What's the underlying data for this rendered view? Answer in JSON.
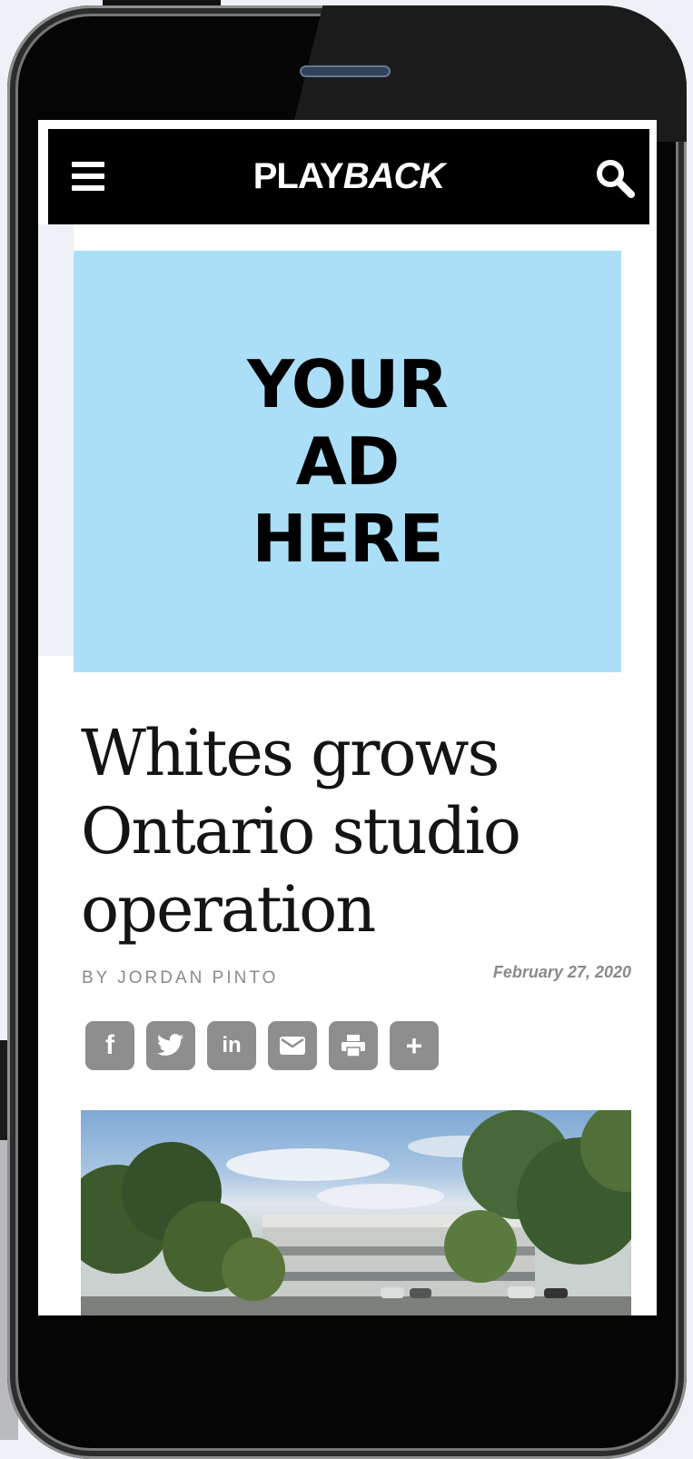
{
  "header": {
    "logo_bold": "PLAY",
    "logo_italic": "BACK"
  },
  "ad": {
    "text": "YOUR\nAD\nHERE"
  },
  "article": {
    "headline": "Whites grows Ontario studio operation",
    "byline": "BY JORDAN PINTO",
    "date": "February 27, 2020"
  },
  "share_buttons": [
    {
      "icon": "facebook-icon",
      "glyph": "f"
    },
    {
      "icon": "twitter-icon"
    },
    {
      "icon": "linkedin-icon",
      "glyph": "in"
    },
    {
      "icon": "email-icon"
    },
    {
      "icon": "print-icon"
    },
    {
      "icon": "plus-icon",
      "glyph": "+"
    }
  ],
  "colors": {
    "header_bg": "#000000",
    "ad_bg": "#abdff7",
    "share_button_bg": "#8e8e8e",
    "meta_text": "#8a8a8a"
  }
}
